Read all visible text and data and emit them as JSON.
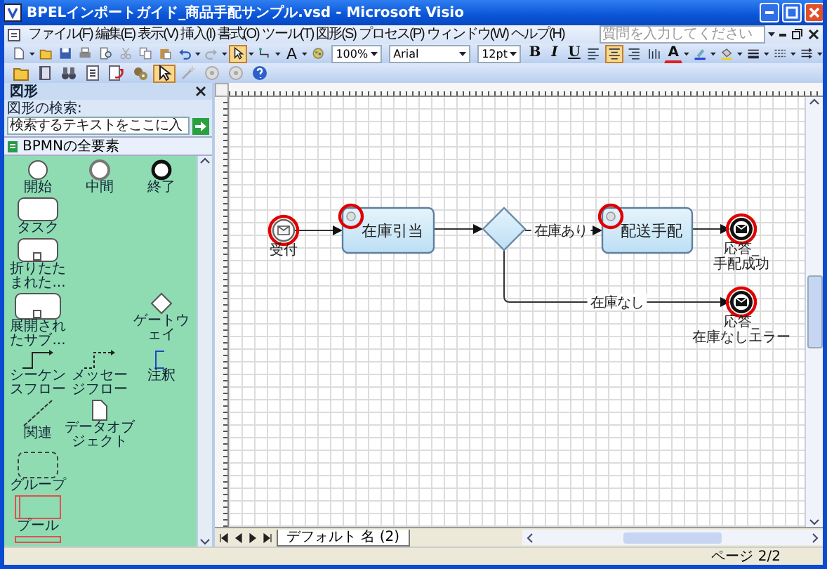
{
  "window": {
    "title": "BPELインポートガイド_商品手配サンプル.vsd - Microsoft Visio"
  },
  "menu": [
    "ファイル(F)",
    "編集(E)",
    "表示(V)",
    "挿入(I)",
    "書式(O)",
    "ツール(T)",
    "図形(S)",
    "プロセス(P)",
    "ウィンドウ(W)",
    "ヘルプ(H)"
  ],
  "help_search": {
    "placeholder": "質問を入力してください"
  },
  "standard_toolbar": [
    {
      "kind": "new",
      "selected": false
    },
    {
      "kind": "open",
      "selected": false
    },
    {
      "kind": "save",
      "selected": false
    },
    {
      "kind": "print",
      "selected": false
    },
    {
      "kind": "preview",
      "selected": false
    },
    {
      "kind": "cut",
      "selected": false
    },
    {
      "kind": "copy",
      "selected": false
    },
    {
      "kind": "paste",
      "selected": false
    },
    {
      "kind": "undo",
      "selected": false
    },
    {
      "kind": "redo",
      "selected": false
    },
    {
      "kind": "pointer",
      "selected": true
    },
    {
      "kind": "connector",
      "selected": false
    },
    {
      "kind": "text",
      "label": "A",
      "selected": false
    },
    {
      "kind": "stamp",
      "selected": false
    }
  ],
  "zoom": {
    "value": "100%"
  },
  "formatting_toolbar": {
    "font": "Arial",
    "size": "12pt",
    "styles": [
      {
        "label": "B"
      },
      {
        "label": "I"
      },
      {
        "label": "U"
      }
    ],
    "align": [
      {
        "kind": "left",
        "selected": false
      },
      {
        "kind": "center",
        "selected": true
      },
      {
        "kind": "right",
        "selected": false
      },
      {
        "kind": "distribute",
        "selected": false
      }
    ],
    "tools": [
      {
        "kind": "font_color",
        "label": "A"
      },
      {
        "kind": "line_color"
      },
      {
        "kind": "fill_color"
      },
      {
        "kind": "line_weight"
      },
      {
        "kind": "line_pattern"
      },
      {
        "kind": "line_ends"
      }
    ]
  },
  "process_toolbar": [
    {
      "kind": "folder",
      "selected": false
    },
    {
      "kind": "book",
      "selected": false
    },
    {
      "kind": "binoculars",
      "selected": false
    },
    {
      "kind": "list",
      "selected": false
    },
    {
      "kind": "check",
      "selected": false
    },
    {
      "kind": "gears",
      "selected": false
    },
    {
      "kind": "pointer",
      "selected": true
    },
    {
      "kind": "wand",
      "selected": false
    },
    {
      "kind": "disc",
      "selected": false
    },
    {
      "kind": "disc",
      "selected": false
    },
    {
      "kind": "help",
      "selected": false
    }
  ],
  "shapes_panel": {
    "title": "図形",
    "search_label": "図形の検索:",
    "search_placeholder": "検索するテキストをここに入",
    "stencil": "BPMNの全要素",
    "shapes": [
      {
        "kind": "start",
        "label": "開始"
      },
      {
        "kind": "intermediate",
        "label": "中間"
      },
      {
        "kind": "end",
        "label": "終了"
      },
      {
        "kind": "task",
        "label": "タスク"
      },
      {
        "kind": "collapsed",
        "label": "折りたたまれた..."
      },
      {
        "kind": "expanded",
        "label": "展開されたサブ..."
      },
      {
        "kind": "gateway",
        "label": "ゲートウェイ"
      },
      {
        "kind": "sequence_flow",
        "label": "シーケンスフロー"
      },
      {
        "kind": "message_flow",
        "label": "メッセージフロー"
      },
      {
        "kind": "annotation",
        "label": "注釈"
      },
      {
        "kind": "association",
        "label": "関連"
      },
      {
        "kind": "data_object",
        "label": "データオブジェクト"
      },
      {
        "kind": "group",
        "label": "グループ"
      },
      {
        "kind": "pool",
        "label": "プール"
      },
      {
        "kind": "lane"
      }
    ]
  },
  "diagram": {
    "nodes": [
      {
        "kind": "start_event",
        "label_lines": [
          "受付"
        ],
        "highlighted": true
      },
      {
        "kind": "task",
        "label": "在庫引当",
        "highlighted": true
      },
      {
        "kind": "gateway",
        "highlighted": false
      },
      {
        "kind": "task",
        "label": "配送手配",
        "highlighted": true
      },
      {
        "kind": "end_event",
        "label_lines": [
          "応答_",
          "手配成功"
        ],
        "highlighted": true
      },
      {
        "kind": "end_event",
        "label_lines": [
          "応答_",
          "在庫なしエラー"
        ],
        "highlighted": true
      }
    ],
    "edges": [
      {
        "kind": "flow"
      },
      {
        "kind": "flow"
      },
      {
        "kind": "flow",
        "label": "在庫あり"
      },
      {
        "kind": "flow"
      },
      {
        "kind": "flow",
        "label": "在庫なし"
      }
    ]
  },
  "page_tabs": [
    {
      "label": "デフォルト 名 (2)",
      "selected": true
    }
  ],
  "status_bar": {
    "page": "ページ 2/2"
  }
}
